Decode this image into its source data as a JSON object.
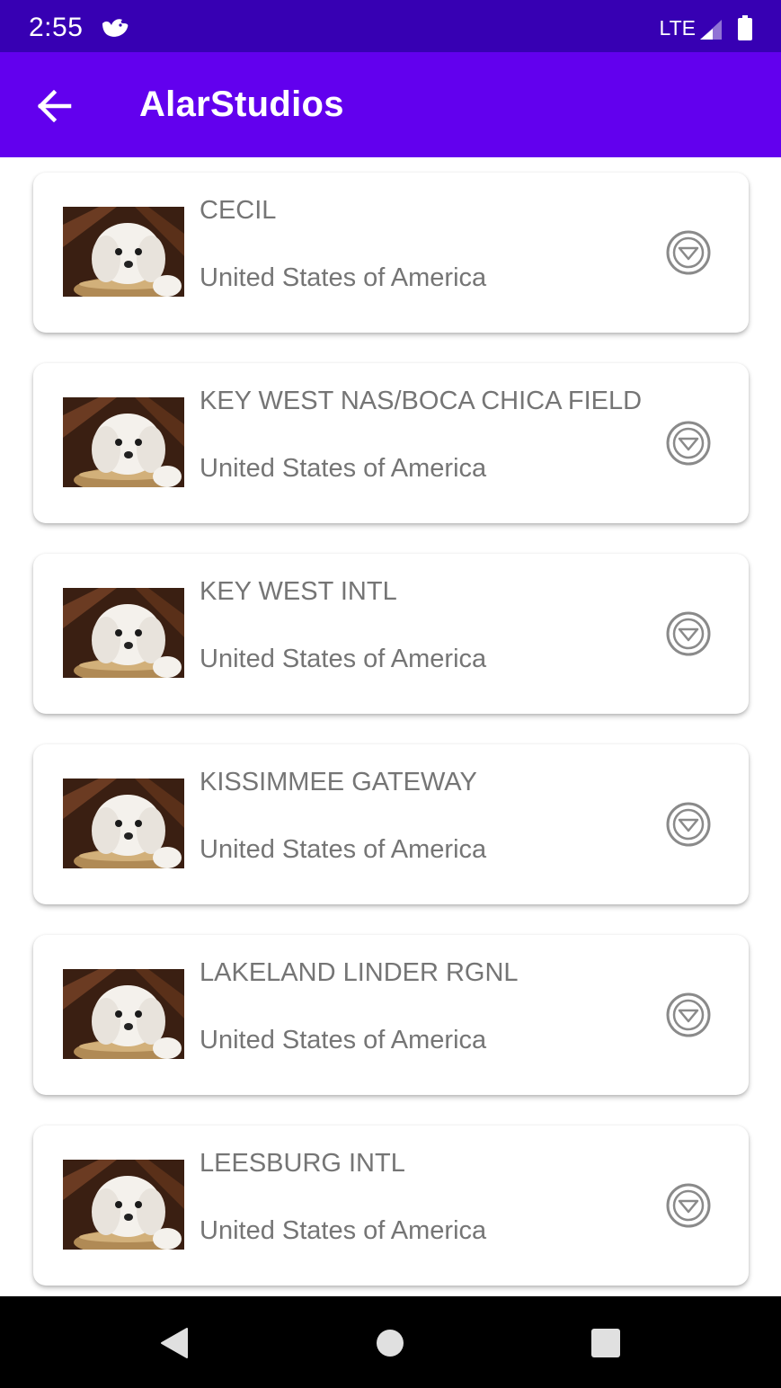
{
  "status_bar": {
    "time": "2:55",
    "network": "LTE",
    "color": "#3700b3"
  },
  "app_bar": {
    "title": "AlarStudios",
    "back_icon": "arrow-back-icon",
    "color": "#6200ee"
  },
  "airports": [
    {
      "name": "CECIL",
      "country": "United States of America"
    },
    {
      "name": "KEY WEST NAS/BOCA CHICA FIELD",
      "country": "United States of America"
    },
    {
      "name": "KEY WEST INTL",
      "country": "United States of America"
    },
    {
      "name": "KISSIMMEE GATEWAY",
      "country": "United States of America"
    },
    {
      "name": "LAKELAND LINDER RGNL",
      "country": "United States of America"
    },
    {
      "name": "LEESBURG INTL",
      "country": "United States of America"
    }
  ],
  "item_icons": {
    "thumbnail": "puppy-photo",
    "action": "expand-circle-down-icon"
  },
  "nav_bar": {
    "back_icon": "nav-back-triangle-icon",
    "home_icon": "nav-home-circle-icon",
    "recents_icon": "nav-recents-square-icon"
  }
}
